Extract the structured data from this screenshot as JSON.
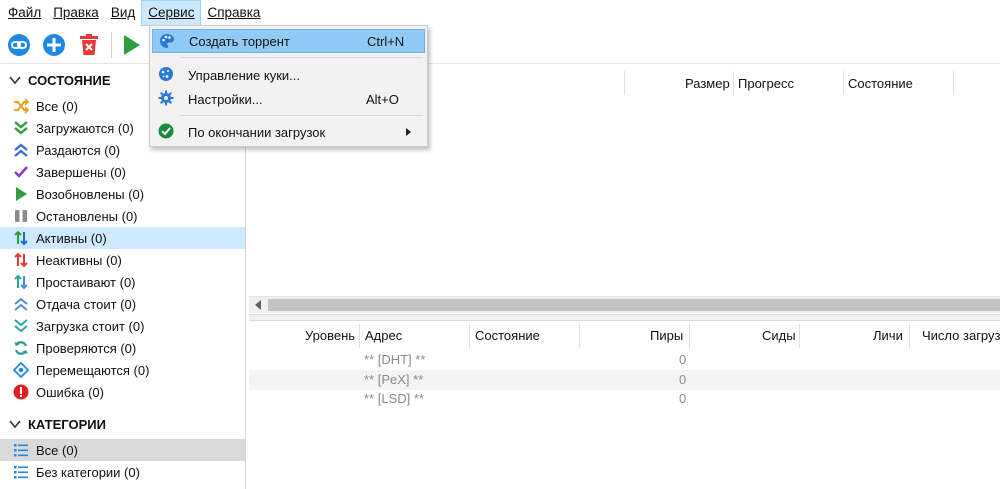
{
  "menubar": {
    "items": [
      {
        "label": "Файл"
      },
      {
        "label": "Правка"
      },
      {
        "label": "Вид"
      },
      {
        "label": "Сервис"
      },
      {
        "label": "Справка"
      }
    ]
  },
  "toolbar": {
    "buttons": [
      {
        "icon": "link-icon",
        "color": "#1e88e5"
      },
      {
        "icon": "add-icon",
        "color": "#1e88e5"
      },
      {
        "icon": "delete-icon",
        "color": "#e53935"
      },
      {
        "icon": "play-icon",
        "color": "#2e9e3e"
      }
    ]
  },
  "dropdown": {
    "items": [
      {
        "label": "Создать торрент",
        "shortcut": "Ctrl+N",
        "icon": "palette-icon"
      },
      {
        "label": "Управление куки...",
        "shortcut": "",
        "icon": "cookie-icon"
      },
      {
        "label": "Настройки...",
        "shortcut": "Alt+O",
        "icon": "gear-icon"
      },
      {
        "label": "По окончании загрузок",
        "shortcut": "",
        "icon": "check-circle-icon"
      }
    ]
  },
  "sidebar": {
    "status_header": "СОСТОЯНИЕ",
    "status_items": [
      {
        "label": "Все (0)",
        "icon": "shuffle-icon",
        "color": "#e8a017"
      },
      {
        "label": "Загружаются (0)",
        "icon": "double-chevron-down-icon",
        "color": "#2e9e3e"
      },
      {
        "label": "Раздаются (0)",
        "icon": "double-chevron-up-icon",
        "color": "#3d6ed0"
      },
      {
        "label": "Завершены (0)",
        "icon": "check-icon",
        "color": "#8a3fc6"
      },
      {
        "label": "Возобновлены (0)",
        "icon": "play-icon",
        "color": "#2e9e3e"
      },
      {
        "label": "Остановлены (0)",
        "icon": "pause-icon",
        "color": "#8a8a8a"
      },
      {
        "label": "Активны (0)",
        "icon": "updown-arrows-icon",
        "color": "#2e9e3e"
      },
      {
        "label": "Неактивны (0)",
        "icon": "updown-arrows-icon",
        "color": "#e53935"
      },
      {
        "label": "Простаивают (0)",
        "icon": "updown-arrows-icon",
        "color": "#2aa6a0"
      },
      {
        "label": "Отдача стоит (0)",
        "icon": "double-chevron-up-icon",
        "color": "#4a90d9"
      },
      {
        "label": "Загрузка стоит (0)",
        "icon": "double-chevron-down-icon",
        "color": "#2aa6a0"
      },
      {
        "label": "Проверяются (0)",
        "icon": "refresh-icon",
        "color": "#2a9d8f"
      },
      {
        "label": "Перемещаются (0)",
        "icon": "move-icon",
        "color": "#1e88e5"
      },
      {
        "label": "Ошибка (0)",
        "icon": "error-icon",
        "color": "#e01e1e"
      }
    ],
    "categories_header": "КАТЕГОРИИ",
    "category_items": [
      {
        "label": "Все (0)",
        "icon": "list-icon",
        "color": "#1e88e5"
      },
      {
        "label": "Без категории (0)",
        "icon": "list-icon",
        "color": "#1e88e5"
      }
    ]
  },
  "transfer_list": {
    "columns": [
      "Размер",
      "Прогресс",
      "Состояние"
    ]
  },
  "trackers": {
    "columns": [
      "Уровень",
      "Адрес",
      "Состояние",
      "Пиры",
      "Сиды",
      "Личи",
      "Число загруз"
    ],
    "rows": [
      {
        "address": "** [DHT] **",
        "peers": "0"
      },
      {
        "address": "** [PeX] **",
        "peers": "0"
      },
      {
        "address": "** [LSD] **",
        "peers": "0"
      }
    ]
  }
}
